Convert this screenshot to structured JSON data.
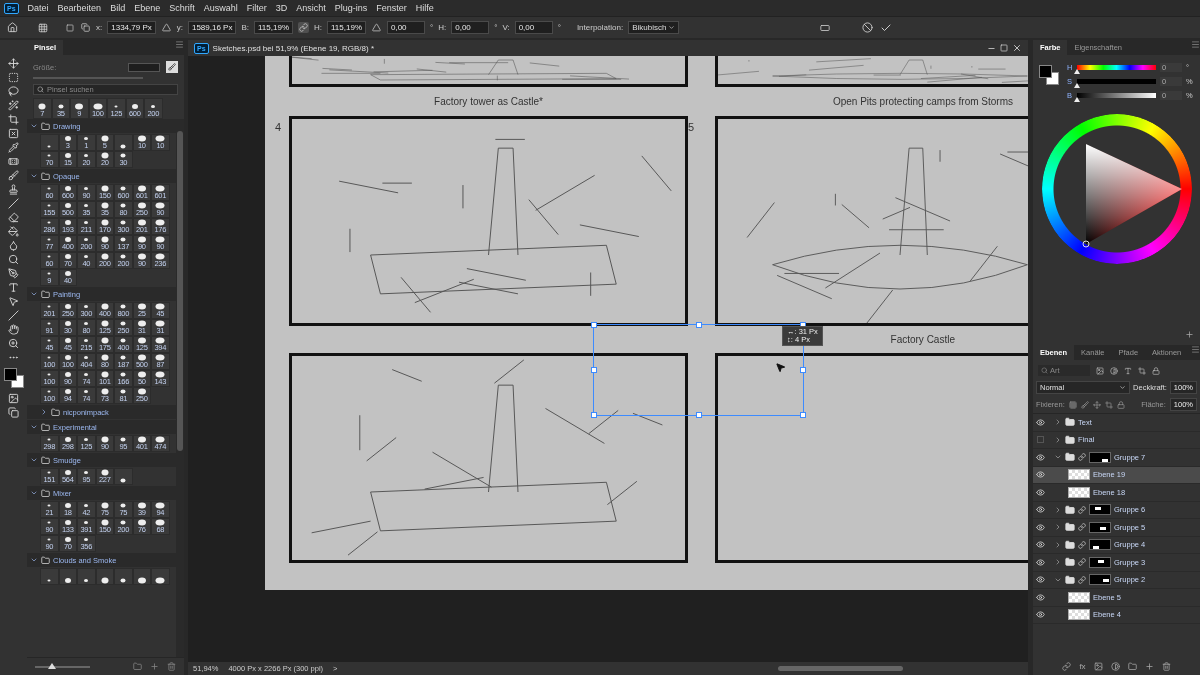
{
  "app": {
    "logo": "Ps",
    "menu": [
      "Datei",
      "Bearbeiten",
      "Bild",
      "Ebene",
      "Schrift",
      "Auswahl",
      "Filter",
      "3D",
      "Ansicht",
      "Plug-ins",
      "Fenster",
      "Hilfe"
    ]
  },
  "options_bar": {
    "items": [
      {
        "kind": "field",
        "label": "x:",
        "value": "1334,79 Px"
      },
      {
        "kind": "delta-toggle"
      },
      {
        "kind": "field",
        "label": "y:",
        "value": "1589,16 Px"
      },
      {
        "kind": "field",
        "label": "B:",
        "value": "115,19%"
      },
      {
        "kind": "link-toggle"
      },
      {
        "kind": "field",
        "label": "H:",
        "value": "115,19%"
      },
      {
        "kind": "angle-field",
        "value": "0,00",
        "unit": "°"
      },
      {
        "kind": "field",
        "label": "H:",
        "value": "0,00",
        "unit": "°"
      },
      {
        "kind": "field",
        "label": "V:",
        "value": "0,00",
        "unit": "°"
      }
    ],
    "interpolation": {
      "label": "Interpolation:",
      "value": "Bikubisch"
    }
  },
  "brushes": {
    "tab": "Pinsel",
    "size_label": "Größe:",
    "search_placeholder": "Pinsel suchen",
    "presets": [
      "7",
      "35",
      "9",
      "100",
      "125",
      "600",
      "200"
    ],
    "groups": [
      {
        "name": "Drawing",
        "expanded": true,
        "tips": [
          {
            "kind": "blank"
          },
          {
            "kind": "labeled",
            "label": "3"
          },
          {
            "kind": "labeled",
            "label": "1"
          },
          {
            "kind": "labeled",
            "label": "5"
          },
          {
            "kind": "blank"
          },
          {
            "kind": "labeled",
            "label": "10"
          },
          {
            "kind": "labeled",
            "label": "10"
          },
          {
            "kind": "labeled",
            "label": "70"
          },
          {
            "kind": "labeled",
            "label": "15"
          },
          {
            "kind": "labeled",
            "label": "20"
          },
          {
            "kind": "labeled",
            "label": "20"
          },
          {
            "kind": "labeled",
            "label": "30"
          }
        ]
      },
      {
        "name": "Opaque",
        "expanded": true,
        "tips": [
          {
            "kind": "labeled",
            "label": "60"
          },
          {
            "kind": "labeled",
            "label": "600"
          },
          {
            "kind": "labeled",
            "label": "90"
          },
          {
            "kind": "labeled",
            "label": "150"
          },
          {
            "kind": "labeled",
            "label": "600"
          },
          {
            "kind": "labeled",
            "label": "601"
          },
          {
            "kind": "labeled",
            "label": "601"
          },
          {
            "kind": "labeled",
            "label": "155"
          },
          {
            "kind": "labeled",
            "label": "500"
          },
          {
            "kind": "labeled",
            "label": "35"
          },
          {
            "kind": "labeled",
            "label": "35"
          },
          {
            "kind": "labeled",
            "label": "80"
          },
          {
            "kind": "labeled",
            "label": "250"
          },
          {
            "kind": "labeled",
            "label": "90"
          },
          {
            "kind": "labeled",
            "label": "286"
          },
          {
            "kind": "labeled",
            "label": "193"
          },
          {
            "kind": "labeled",
            "label": "211"
          },
          {
            "kind": "labeled",
            "label": "170"
          },
          {
            "kind": "labeled",
            "label": "300"
          },
          {
            "kind": "labeled",
            "label": "201"
          },
          {
            "kind": "labeled",
            "label": "176"
          },
          {
            "kind": "labeled",
            "label": "77"
          },
          {
            "kind": "labeled",
            "label": "400"
          },
          {
            "kind": "labeled",
            "label": "200"
          },
          {
            "kind": "labeled",
            "label": "90"
          },
          {
            "kind": "labeled",
            "label": "137"
          },
          {
            "kind": "labeled",
            "label": "90"
          },
          {
            "kind": "labeled",
            "label": "90"
          },
          {
            "kind": "labeled",
            "label": "60"
          },
          {
            "kind": "labeled",
            "label": "70"
          },
          {
            "kind": "labeled",
            "label": "40"
          },
          {
            "kind": "labeled",
            "label": "200"
          },
          {
            "kind": "labeled",
            "label": "200"
          },
          {
            "kind": "labeled",
            "label": "90"
          },
          {
            "kind": "labeled",
            "label": "236"
          },
          {
            "kind": "labeled",
            "label": "9"
          },
          {
            "kind": "labeled",
            "label": "40"
          }
        ]
      },
      {
        "name": "Painting",
        "expanded": true,
        "tips": [
          {
            "kind": "labeled",
            "label": "201"
          },
          {
            "kind": "labeled",
            "label": "250"
          },
          {
            "kind": "labeled",
            "label": "300"
          },
          {
            "kind": "labeled",
            "label": "400"
          },
          {
            "kind": "labeled",
            "label": "800"
          },
          {
            "kind": "labeled",
            "label": "25"
          },
          {
            "kind": "labeled",
            "label": "45"
          },
          {
            "kind": "labeled",
            "label": "91"
          },
          {
            "kind": "labeled",
            "label": "30"
          },
          {
            "kind": "labeled",
            "label": "80"
          },
          {
            "kind": "labeled",
            "label": "125"
          },
          {
            "kind": "labeled",
            "label": "250"
          },
          {
            "kind": "labeled",
            "label": "31"
          },
          {
            "kind": "labeled",
            "label": "31"
          },
          {
            "kind": "labeled",
            "label": "45"
          },
          {
            "kind": "labeled",
            "label": "45"
          },
          {
            "kind": "labeled",
            "label": "215"
          },
          {
            "kind": "labeled",
            "label": "175"
          },
          {
            "kind": "labeled",
            "label": "400"
          },
          {
            "kind": "labeled",
            "label": "125"
          },
          {
            "kind": "labeled",
            "label": "394"
          },
          {
            "kind": "labeled",
            "label": "100"
          },
          {
            "kind": "labeled",
            "label": "100"
          },
          {
            "kind": "labeled",
            "label": "404"
          },
          {
            "kind": "labeled",
            "label": "80"
          },
          {
            "kind": "labeled",
            "label": "187"
          },
          {
            "kind": "labeled",
            "label": "500"
          },
          {
            "kind": "labeled",
            "label": "87"
          },
          {
            "kind": "labeled",
            "label": "100"
          },
          {
            "kind": "labeled",
            "label": "90"
          },
          {
            "kind": "labeled",
            "label": "74"
          },
          {
            "kind": "labeled",
            "label": "101"
          },
          {
            "kind": "labeled",
            "label": "166"
          },
          {
            "kind": "labeled",
            "label": "50"
          },
          {
            "kind": "labeled",
            "label": "143"
          },
          {
            "kind": "labeled",
            "label": "100"
          },
          {
            "kind": "labeled",
            "label": "94"
          },
          {
            "kind": "labeled",
            "label": "74"
          },
          {
            "kind": "labeled",
            "label": "73"
          },
          {
            "kind": "labeled",
            "label": "81"
          },
          {
            "kind": "labeled",
            "label": "250"
          }
        ],
        "children": [
          {
            "name": "nicponimpack",
            "expanded": false
          }
        ]
      },
      {
        "name": "Experimental",
        "expanded": true,
        "tips": [
          {
            "kind": "labeled",
            "label": "298"
          },
          {
            "kind": "labeled",
            "label": "298"
          },
          {
            "kind": "labeled",
            "label": "125"
          },
          {
            "kind": "labeled",
            "label": "90"
          },
          {
            "kind": "labeled",
            "label": "95"
          },
          {
            "kind": "labeled",
            "label": "401"
          },
          {
            "kind": "labeled",
            "label": "474"
          }
        ]
      },
      {
        "name": "Smudge",
        "expanded": true,
        "tips": [
          {
            "kind": "labeled",
            "label": "151"
          },
          {
            "kind": "labeled",
            "label": "564"
          },
          {
            "kind": "labeled",
            "label": "95"
          },
          {
            "kind": "labeled",
            "label": "227"
          },
          {
            "kind": "blank"
          }
        ]
      },
      {
        "name": "Mixer",
        "expanded": true,
        "tips": [
          {
            "kind": "labeled",
            "label": "21"
          },
          {
            "kind": "labeled",
            "label": "18"
          },
          {
            "kind": "labeled",
            "label": "42"
          },
          {
            "kind": "labeled",
            "label": "75"
          },
          {
            "kind": "labeled",
            "label": "75"
          },
          {
            "kind": "labeled",
            "label": "39"
          },
          {
            "kind": "labeled",
            "label": "94"
          },
          {
            "kind": "labeled",
            "label": "90"
          },
          {
            "kind": "labeled",
            "label": "133"
          },
          {
            "kind": "labeled",
            "label": "391"
          },
          {
            "kind": "labeled",
            "label": "150"
          },
          {
            "kind": "labeled",
            "label": "200"
          },
          {
            "kind": "labeled",
            "label": "76"
          },
          {
            "kind": "labeled",
            "label": "68"
          },
          {
            "kind": "labeled",
            "label": "90"
          },
          {
            "kind": "labeled",
            "label": "70"
          },
          {
            "kind": "labeled",
            "label": "356"
          }
        ]
      },
      {
        "name": "Clouds and Smoke",
        "expanded": true,
        "tips": [
          {
            "kind": "blank"
          },
          {
            "kind": "blank"
          },
          {
            "kind": "blank"
          },
          {
            "kind": "blank"
          },
          {
            "kind": "blank"
          },
          {
            "kind": "blank"
          },
          {
            "kind": "blank"
          }
        ]
      }
    ],
    "preview_size": {
      "level": 0.3
    }
  },
  "document": {
    "logo": "Ps",
    "title": "Sketches.psd bei 51,9% (Ebene 19, RGB/8) *",
    "rows": [
      {
        "kind": "cut",
        "frames": [
          {
            "kind": "sketch",
            "caption": "Factory tower as Castle*"
          },
          {
            "kind": "sketch",
            "caption": "Open Pits protecting camps from Storms"
          }
        ]
      },
      {
        "kind": "full",
        "frames": [
          {
            "kind": "sketch",
            "number": "4"
          },
          {
            "kind": "sketch",
            "number": "5",
            "caption": "Factory Castle"
          }
        ]
      },
      {
        "kind": "full",
        "frames": [
          {
            "kind": "sketch"
          },
          {
            "kind": "empty"
          }
        ]
      }
    ],
    "transform_readout": [
      "↔: 31 Px",
      "↕: 4 Px"
    ],
    "status": {
      "zoom": "51,94%",
      "info": "4000 Px x 2266 Px (300 ppi)",
      "arrow": ">"
    }
  },
  "color_panel": {
    "tabs": [
      {
        "label": "Farbe",
        "selected": true
      },
      {
        "label": "Eigenschaften",
        "selected": false
      }
    ],
    "sliders": [
      {
        "kind": "hue",
        "label": "H",
        "level": 0,
        "value": "0",
        "unit": "°"
      },
      {
        "kind": "saturation",
        "label": "S",
        "level": 0,
        "value": "0",
        "unit": "%"
      },
      {
        "kind": "brightness",
        "label": "B",
        "level": 0,
        "value": "0",
        "unit": "%"
      }
    ]
  },
  "layers_panel": {
    "tabs": [
      {
        "label": "Ebenen",
        "selected": true
      },
      {
        "label": "Kanäle",
        "selected": false
      },
      {
        "label": "Pfade",
        "selected": false
      },
      {
        "label": "Aktionen",
        "selected": false
      }
    ],
    "filter_placeholder": "Art",
    "blend_mode": "Normal",
    "opacity_label": "Deckkraft:",
    "opacity": "100%",
    "lock_label": "Fixieren:",
    "fill_label": "Fläche:",
    "fill": "100%",
    "effects_label": "fx",
    "layers": [
      {
        "kind": "group",
        "name": "Text",
        "visible": true,
        "expanded": false,
        "selected": false
      },
      {
        "kind": "group",
        "name": "Final",
        "visible": false,
        "expanded": false,
        "selected": false
      },
      {
        "kind": "masked-group",
        "name": "Gruppe 7",
        "visible": true,
        "expanded": true,
        "selected": false,
        "children": [
          {
            "kind": "layer",
            "name": "Ebene 19",
            "visible": true,
            "selected": true
          },
          {
            "kind": "layer",
            "name": "Ebene 18",
            "visible": true,
            "selected": false
          }
        ]
      },
      {
        "kind": "masked-group",
        "name": "Gruppe 6",
        "visible": true,
        "expanded": false,
        "selected": false
      },
      {
        "kind": "masked-group",
        "name": "Gruppe 5",
        "visible": true,
        "expanded": false,
        "selected": false
      },
      {
        "kind": "masked-group",
        "name": "Gruppe 4",
        "visible": true,
        "expanded": false,
        "selected": false
      },
      {
        "kind": "masked-group",
        "name": "Gruppe 3",
        "visible": true,
        "expanded": false,
        "selected": false
      },
      {
        "kind": "masked-group",
        "name": "Gruppe 2",
        "visible": true,
        "expanded": true,
        "selected": false,
        "children": [
          {
            "kind": "layer",
            "name": "Ebene 5",
            "visible": true,
            "selected": false
          },
          {
            "kind": "layer",
            "name": "Ebene 4",
            "visible": true,
            "selected": false
          }
        ]
      }
    ]
  }
}
